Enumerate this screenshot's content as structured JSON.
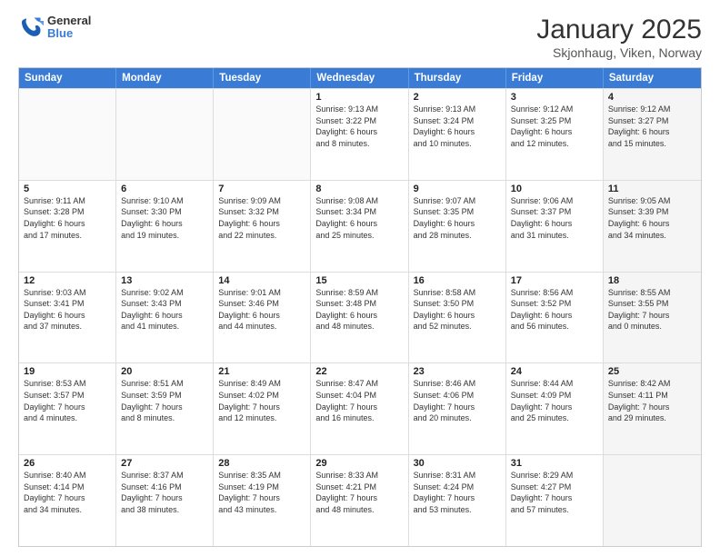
{
  "header": {
    "logo_general": "General",
    "logo_blue": "Blue",
    "title": "January 2025",
    "subtitle": "Skjonhaug, Viken, Norway"
  },
  "weekdays": [
    "Sunday",
    "Monday",
    "Tuesday",
    "Wednesday",
    "Thursday",
    "Friday",
    "Saturday"
  ],
  "rows": [
    [
      {
        "day": "",
        "text": "",
        "empty": true
      },
      {
        "day": "",
        "text": "",
        "empty": true
      },
      {
        "day": "",
        "text": "",
        "empty": true
      },
      {
        "day": "1",
        "text": "Sunrise: 9:13 AM\nSunset: 3:22 PM\nDaylight: 6 hours\nand 8 minutes.",
        "empty": false
      },
      {
        "day": "2",
        "text": "Sunrise: 9:13 AM\nSunset: 3:24 PM\nDaylight: 6 hours\nand 10 minutes.",
        "empty": false
      },
      {
        "day": "3",
        "text": "Sunrise: 9:12 AM\nSunset: 3:25 PM\nDaylight: 6 hours\nand 12 minutes.",
        "empty": false
      },
      {
        "day": "4",
        "text": "Sunrise: 9:12 AM\nSunset: 3:27 PM\nDaylight: 6 hours\nand 15 minutes.",
        "empty": false,
        "shaded": true
      }
    ],
    [
      {
        "day": "5",
        "text": "Sunrise: 9:11 AM\nSunset: 3:28 PM\nDaylight: 6 hours\nand 17 minutes.",
        "empty": false
      },
      {
        "day": "6",
        "text": "Sunrise: 9:10 AM\nSunset: 3:30 PM\nDaylight: 6 hours\nand 19 minutes.",
        "empty": false
      },
      {
        "day": "7",
        "text": "Sunrise: 9:09 AM\nSunset: 3:32 PM\nDaylight: 6 hours\nand 22 minutes.",
        "empty": false
      },
      {
        "day": "8",
        "text": "Sunrise: 9:08 AM\nSunset: 3:34 PM\nDaylight: 6 hours\nand 25 minutes.",
        "empty": false
      },
      {
        "day": "9",
        "text": "Sunrise: 9:07 AM\nSunset: 3:35 PM\nDaylight: 6 hours\nand 28 minutes.",
        "empty": false
      },
      {
        "day": "10",
        "text": "Sunrise: 9:06 AM\nSunset: 3:37 PM\nDaylight: 6 hours\nand 31 minutes.",
        "empty": false
      },
      {
        "day": "11",
        "text": "Sunrise: 9:05 AM\nSunset: 3:39 PM\nDaylight: 6 hours\nand 34 minutes.",
        "empty": false,
        "shaded": true
      }
    ],
    [
      {
        "day": "12",
        "text": "Sunrise: 9:03 AM\nSunset: 3:41 PM\nDaylight: 6 hours\nand 37 minutes.",
        "empty": false
      },
      {
        "day": "13",
        "text": "Sunrise: 9:02 AM\nSunset: 3:43 PM\nDaylight: 6 hours\nand 41 minutes.",
        "empty": false
      },
      {
        "day": "14",
        "text": "Sunrise: 9:01 AM\nSunset: 3:46 PM\nDaylight: 6 hours\nand 44 minutes.",
        "empty": false
      },
      {
        "day": "15",
        "text": "Sunrise: 8:59 AM\nSunset: 3:48 PM\nDaylight: 6 hours\nand 48 minutes.",
        "empty": false
      },
      {
        "day": "16",
        "text": "Sunrise: 8:58 AM\nSunset: 3:50 PM\nDaylight: 6 hours\nand 52 minutes.",
        "empty": false
      },
      {
        "day": "17",
        "text": "Sunrise: 8:56 AM\nSunset: 3:52 PM\nDaylight: 6 hours\nand 56 minutes.",
        "empty": false
      },
      {
        "day": "18",
        "text": "Sunrise: 8:55 AM\nSunset: 3:55 PM\nDaylight: 7 hours\nand 0 minutes.",
        "empty": false,
        "shaded": true
      }
    ],
    [
      {
        "day": "19",
        "text": "Sunrise: 8:53 AM\nSunset: 3:57 PM\nDaylight: 7 hours\nand 4 minutes.",
        "empty": false
      },
      {
        "day": "20",
        "text": "Sunrise: 8:51 AM\nSunset: 3:59 PM\nDaylight: 7 hours\nand 8 minutes.",
        "empty": false
      },
      {
        "day": "21",
        "text": "Sunrise: 8:49 AM\nSunset: 4:02 PM\nDaylight: 7 hours\nand 12 minutes.",
        "empty": false
      },
      {
        "day": "22",
        "text": "Sunrise: 8:47 AM\nSunset: 4:04 PM\nDaylight: 7 hours\nand 16 minutes.",
        "empty": false
      },
      {
        "day": "23",
        "text": "Sunrise: 8:46 AM\nSunset: 4:06 PM\nDaylight: 7 hours\nand 20 minutes.",
        "empty": false
      },
      {
        "day": "24",
        "text": "Sunrise: 8:44 AM\nSunset: 4:09 PM\nDaylight: 7 hours\nand 25 minutes.",
        "empty": false
      },
      {
        "day": "25",
        "text": "Sunrise: 8:42 AM\nSunset: 4:11 PM\nDaylight: 7 hours\nand 29 minutes.",
        "empty": false,
        "shaded": true
      }
    ],
    [
      {
        "day": "26",
        "text": "Sunrise: 8:40 AM\nSunset: 4:14 PM\nDaylight: 7 hours\nand 34 minutes.",
        "empty": false
      },
      {
        "day": "27",
        "text": "Sunrise: 8:37 AM\nSunset: 4:16 PM\nDaylight: 7 hours\nand 38 minutes.",
        "empty": false
      },
      {
        "day": "28",
        "text": "Sunrise: 8:35 AM\nSunset: 4:19 PM\nDaylight: 7 hours\nand 43 minutes.",
        "empty": false
      },
      {
        "day": "29",
        "text": "Sunrise: 8:33 AM\nSunset: 4:21 PM\nDaylight: 7 hours\nand 48 minutes.",
        "empty": false
      },
      {
        "day": "30",
        "text": "Sunrise: 8:31 AM\nSunset: 4:24 PM\nDaylight: 7 hours\nand 53 minutes.",
        "empty": false
      },
      {
        "day": "31",
        "text": "Sunrise: 8:29 AM\nSunset: 4:27 PM\nDaylight: 7 hours\nand 57 minutes.",
        "empty": false
      },
      {
        "day": "",
        "text": "",
        "empty": true,
        "shaded": true
      }
    ]
  ]
}
